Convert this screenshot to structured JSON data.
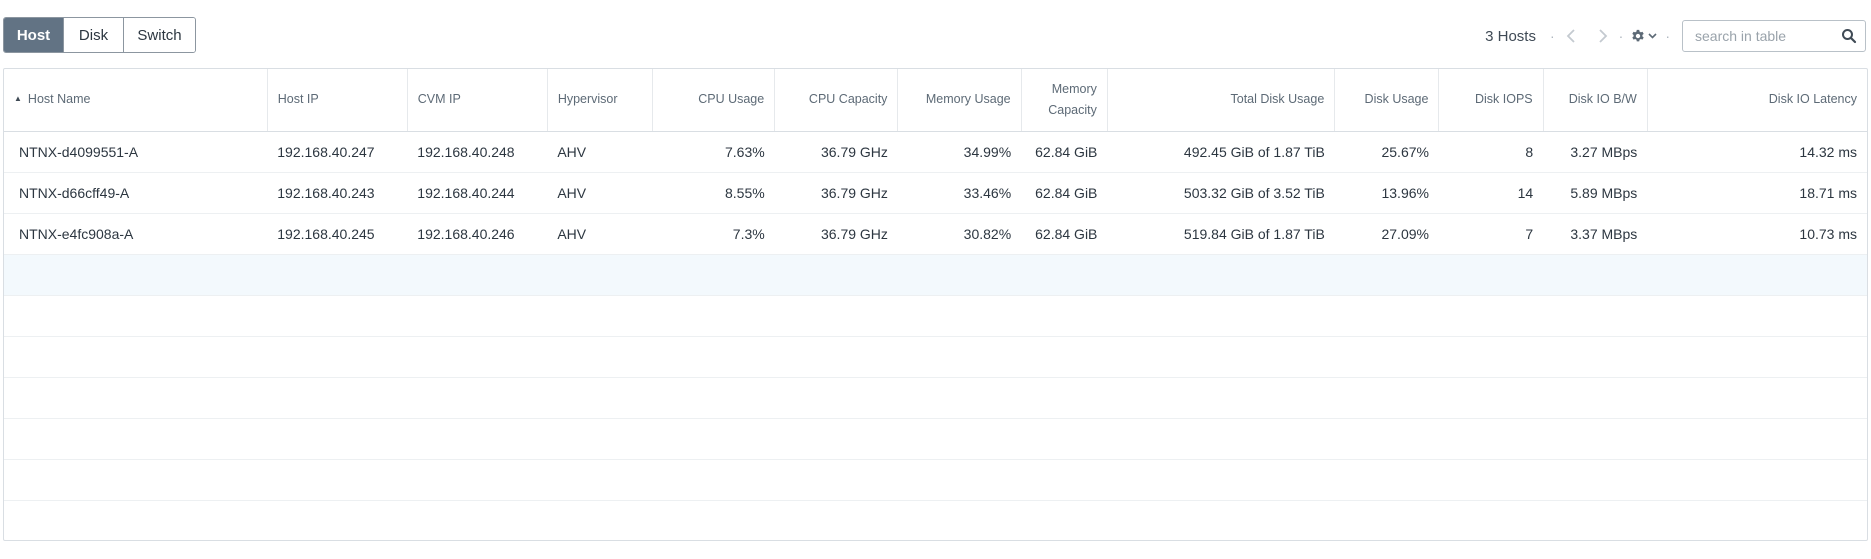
{
  "tabs": [
    {
      "label": "Host",
      "active": true
    },
    {
      "label": "Disk",
      "active": false
    },
    {
      "label": "Switch",
      "active": false
    }
  ],
  "toolbar": {
    "count_label": "3 Hosts",
    "separator": "·",
    "search_placeholder": "search in table"
  },
  "icons": {
    "prev": "chevron-left-icon",
    "next": "chevron-right-icon",
    "settings": "gear-icon",
    "dropdown": "chevron-down-icon",
    "search": "search-icon",
    "sort": "sort-ascending-icon"
  },
  "colors": {
    "active_tab": "#627384",
    "row_hover": "#f3f9fd"
  },
  "table": {
    "columns": [
      "Host Name",
      "Host IP",
      "CVM IP",
      "Hypervisor",
      "CPU Usage",
      "CPU Capacity",
      "Memory Usage",
      "Memory Capacity",
      "Total Disk Usage",
      "Disk Usage",
      "Disk IOPS",
      "Disk IO B/W",
      "Disk IO Latency"
    ],
    "rows": [
      [
        "NTNX-d4099551-A",
        "192.168.40.247",
        "192.168.40.248",
        "AHV",
        "7.63%",
        "36.79 GHz",
        "34.99%",
        "62.84 GiB",
        "492.45 GiB of 1.87 TiB",
        "25.67%",
        "8",
        "3.27 MBps",
        "14.32 ms"
      ],
      [
        "NTNX-d66cff49-A",
        "192.168.40.243",
        "192.168.40.244",
        "AHV",
        "8.55%",
        "36.79 GHz",
        "33.46%",
        "62.84 GiB",
        "503.32 GiB of 3.52 TiB",
        "13.96%",
        "14",
        "5.89 MBps",
        "18.71 ms"
      ],
      [
        "NTNX-e4fc908a-A",
        "192.168.40.245",
        "192.168.40.246",
        "AHV",
        "7.3%",
        "36.79 GHz",
        "30.82%",
        "62.84 GiB",
        "519.84 GiB of 1.87 TiB",
        "27.09%",
        "7",
        "3.37 MBps",
        "10.73 ms"
      ]
    ]
  }
}
